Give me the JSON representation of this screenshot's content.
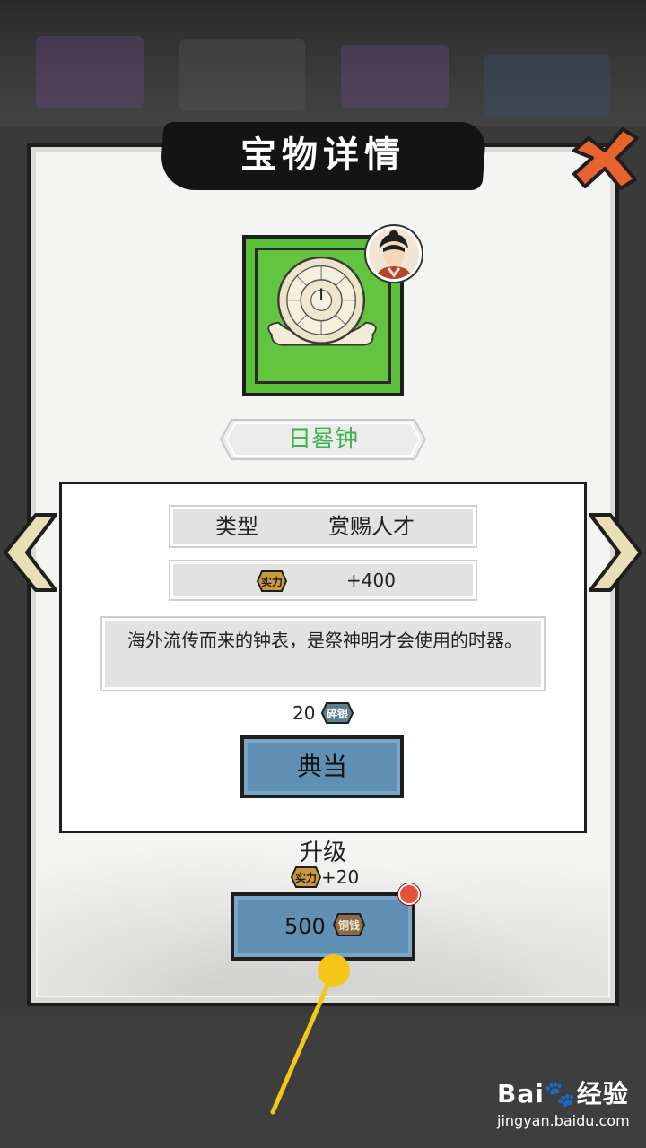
{
  "dialog": {
    "title": "宝物详情",
    "close_icon": "close-x-icon"
  },
  "item": {
    "name": "日晷钟",
    "image": "sundial-clock-image",
    "owner_avatar": "character-avatar"
  },
  "details": {
    "type_label": "类型",
    "type_value": "赏赐人才",
    "power_icon": "实力",
    "power_value": "+400",
    "description": "海外流传而来的钟表，是祭神明才会使用的时器。"
  },
  "pawn": {
    "price": "20",
    "currency_icon": "碎银",
    "button_label": "典当"
  },
  "upgrade": {
    "title": "升级",
    "bonus_icon": "实力",
    "bonus_value": "+20",
    "cost": "500",
    "currency_icon": "铜钱",
    "has_notification": true
  },
  "navigation": {
    "prev_icon": "chevron-left-icon",
    "next_icon": "chevron-right-icon"
  },
  "watermark": {
    "brand": "Bai🐾经验",
    "url": "jingyan.baidu.com"
  },
  "colors": {
    "item_bg": "#5bbf3a",
    "item_name": "#39b54a",
    "button": "#5f8fb2",
    "close": "#e8622e",
    "pointer": "#f5c518"
  }
}
